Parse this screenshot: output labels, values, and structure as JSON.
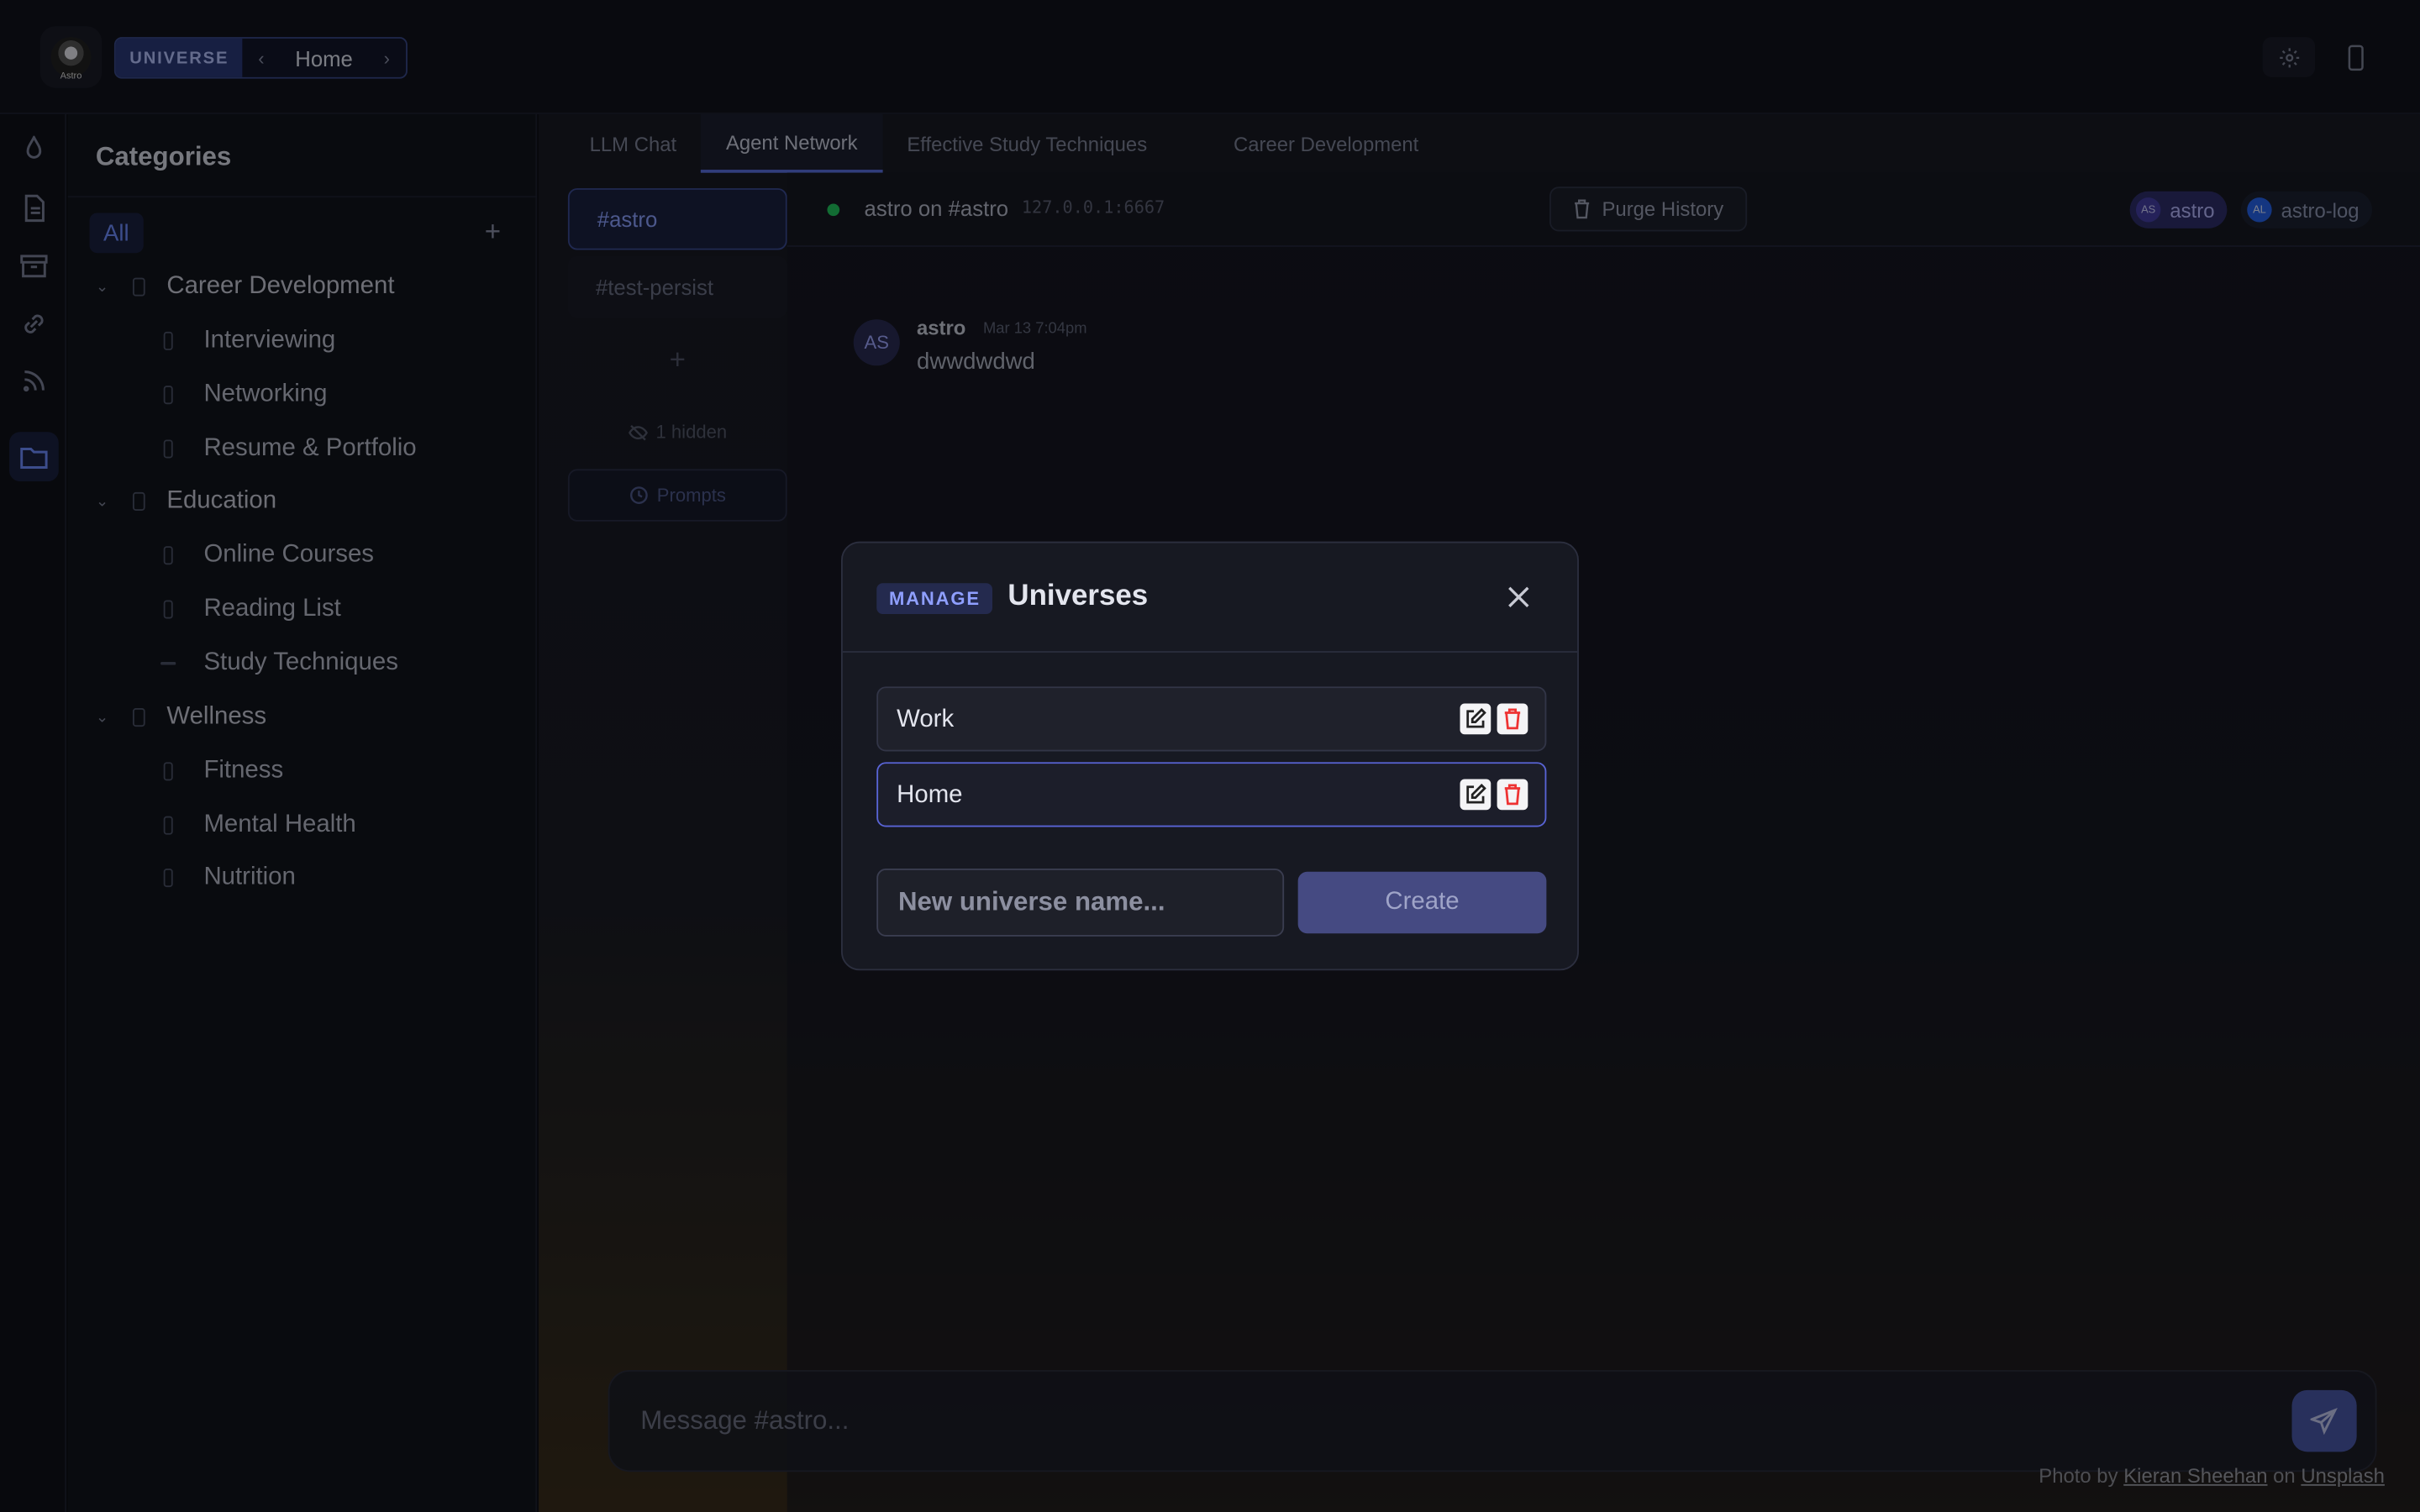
{
  "topbar": {
    "logo_text": "Astro",
    "universe_badge": "UNIVERSE",
    "current_universe": "Home"
  },
  "categories": {
    "title": "Categories",
    "all_label": "All",
    "groups": [
      {
        "label": "Career Development",
        "items": [
          "Interviewing",
          "Networking",
          "Resume & Portfolio"
        ]
      },
      {
        "label": "Education",
        "items": [
          "Online Courses",
          "Reading List",
          "Study Techniques"
        ]
      },
      {
        "label": "Wellness",
        "items": [
          "Fitness",
          "Mental Health",
          "Nutrition"
        ]
      }
    ]
  },
  "tabs": [
    "LLM Chat",
    "Agent Network",
    "Effective Study Techniques",
    "Career Development"
  ],
  "active_tab": "Agent Network",
  "channels": {
    "list": [
      "#astro",
      "#test-persist"
    ],
    "hidden_label": "1 hidden",
    "prompts_label": "Prompts"
  },
  "chat": {
    "title": "astro on #astro",
    "address": "127.0.0.1:6667",
    "purge_label": "Purge History",
    "users": [
      {
        "initials": "AS",
        "name": "astro",
        "color": "#4f46e5"
      },
      {
        "initials": "AL",
        "name": "astro-log",
        "color": "#2563eb"
      }
    ],
    "messages": [
      {
        "initials": "AS",
        "author": "astro",
        "time": "Mar 13 7:04pm",
        "text": "dwwdwdwd"
      }
    ],
    "composer_placeholder": "Message #astro..."
  },
  "credit": {
    "prefix": "Photo by",
    "author": "Kieran Sheehan",
    "middle": "on",
    "site": "Unsplash"
  },
  "modal": {
    "badge": "MANAGE",
    "title": "Universes",
    "universes": [
      {
        "name": "Work",
        "selected": false
      },
      {
        "name": "Home",
        "selected": true
      }
    ],
    "new_placeholder": "New universe name...",
    "create_label": "Create"
  },
  "colors": {
    "accent": "#5a6fe0",
    "online": "#22c55e",
    "danger": "#ee3333"
  }
}
